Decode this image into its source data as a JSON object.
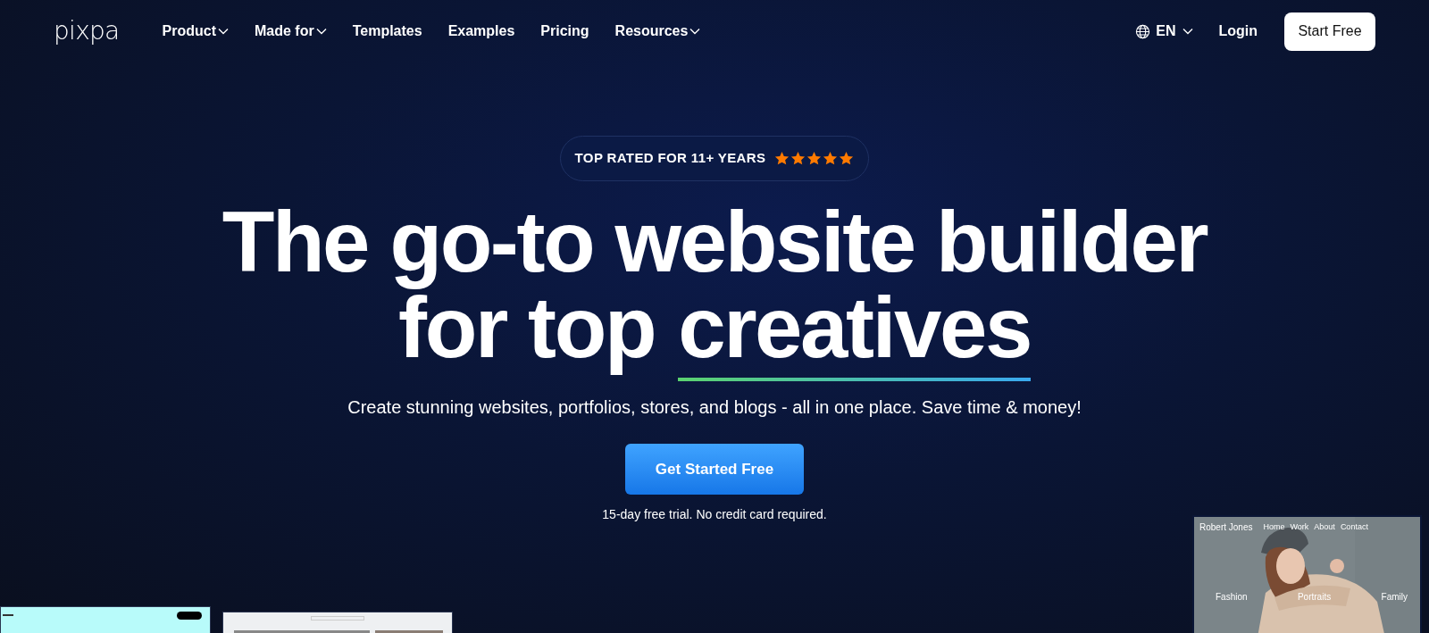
{
  "header": {
    "logo": "pixpa",
    "nav": [
      {
        "label": "Product",
        "dropdown": true
      },
      {
        "label": "Made for",
        "dropdown": true
      },
      {
        "label": "Templates",
        "dropdown": false
      },
      {
        "label": "Examples",
        "dropdown": false
      },
      {
        "label": "Pricing",
        "dropdown": false
      },
      {
        "label": "Resources",
        "dropdown": true
      }
    ],
    "language": "EN",
    "login": "Login",
    "cta": "Start Free"
  },
  "hero": {
    "badge": {
      "text": "TOP RATED FOR 11+ YEARS",
      "stars": 5
    },
    "headline_line_1": "The go-to website builder",
    "headline_line_2_plain": "for top",
    "headline_line_2_highlight": "creatives",
    "subtitle": "Create stunning websites, portfolios, stores, and blogs - all in one place. Save time & money!",
    "button": "Get Started Free",
    "note": "15-day free trial. No credit card required."
  },
  "preview": {
    "site_name": "Robert Jones",
    "nav": [
      "Home",
      "Work",
      "About",
      "Contact"
    ],
    "categories": [
      "Fashion",
      "Portraits",
      "Family"
    ]
  }
}
